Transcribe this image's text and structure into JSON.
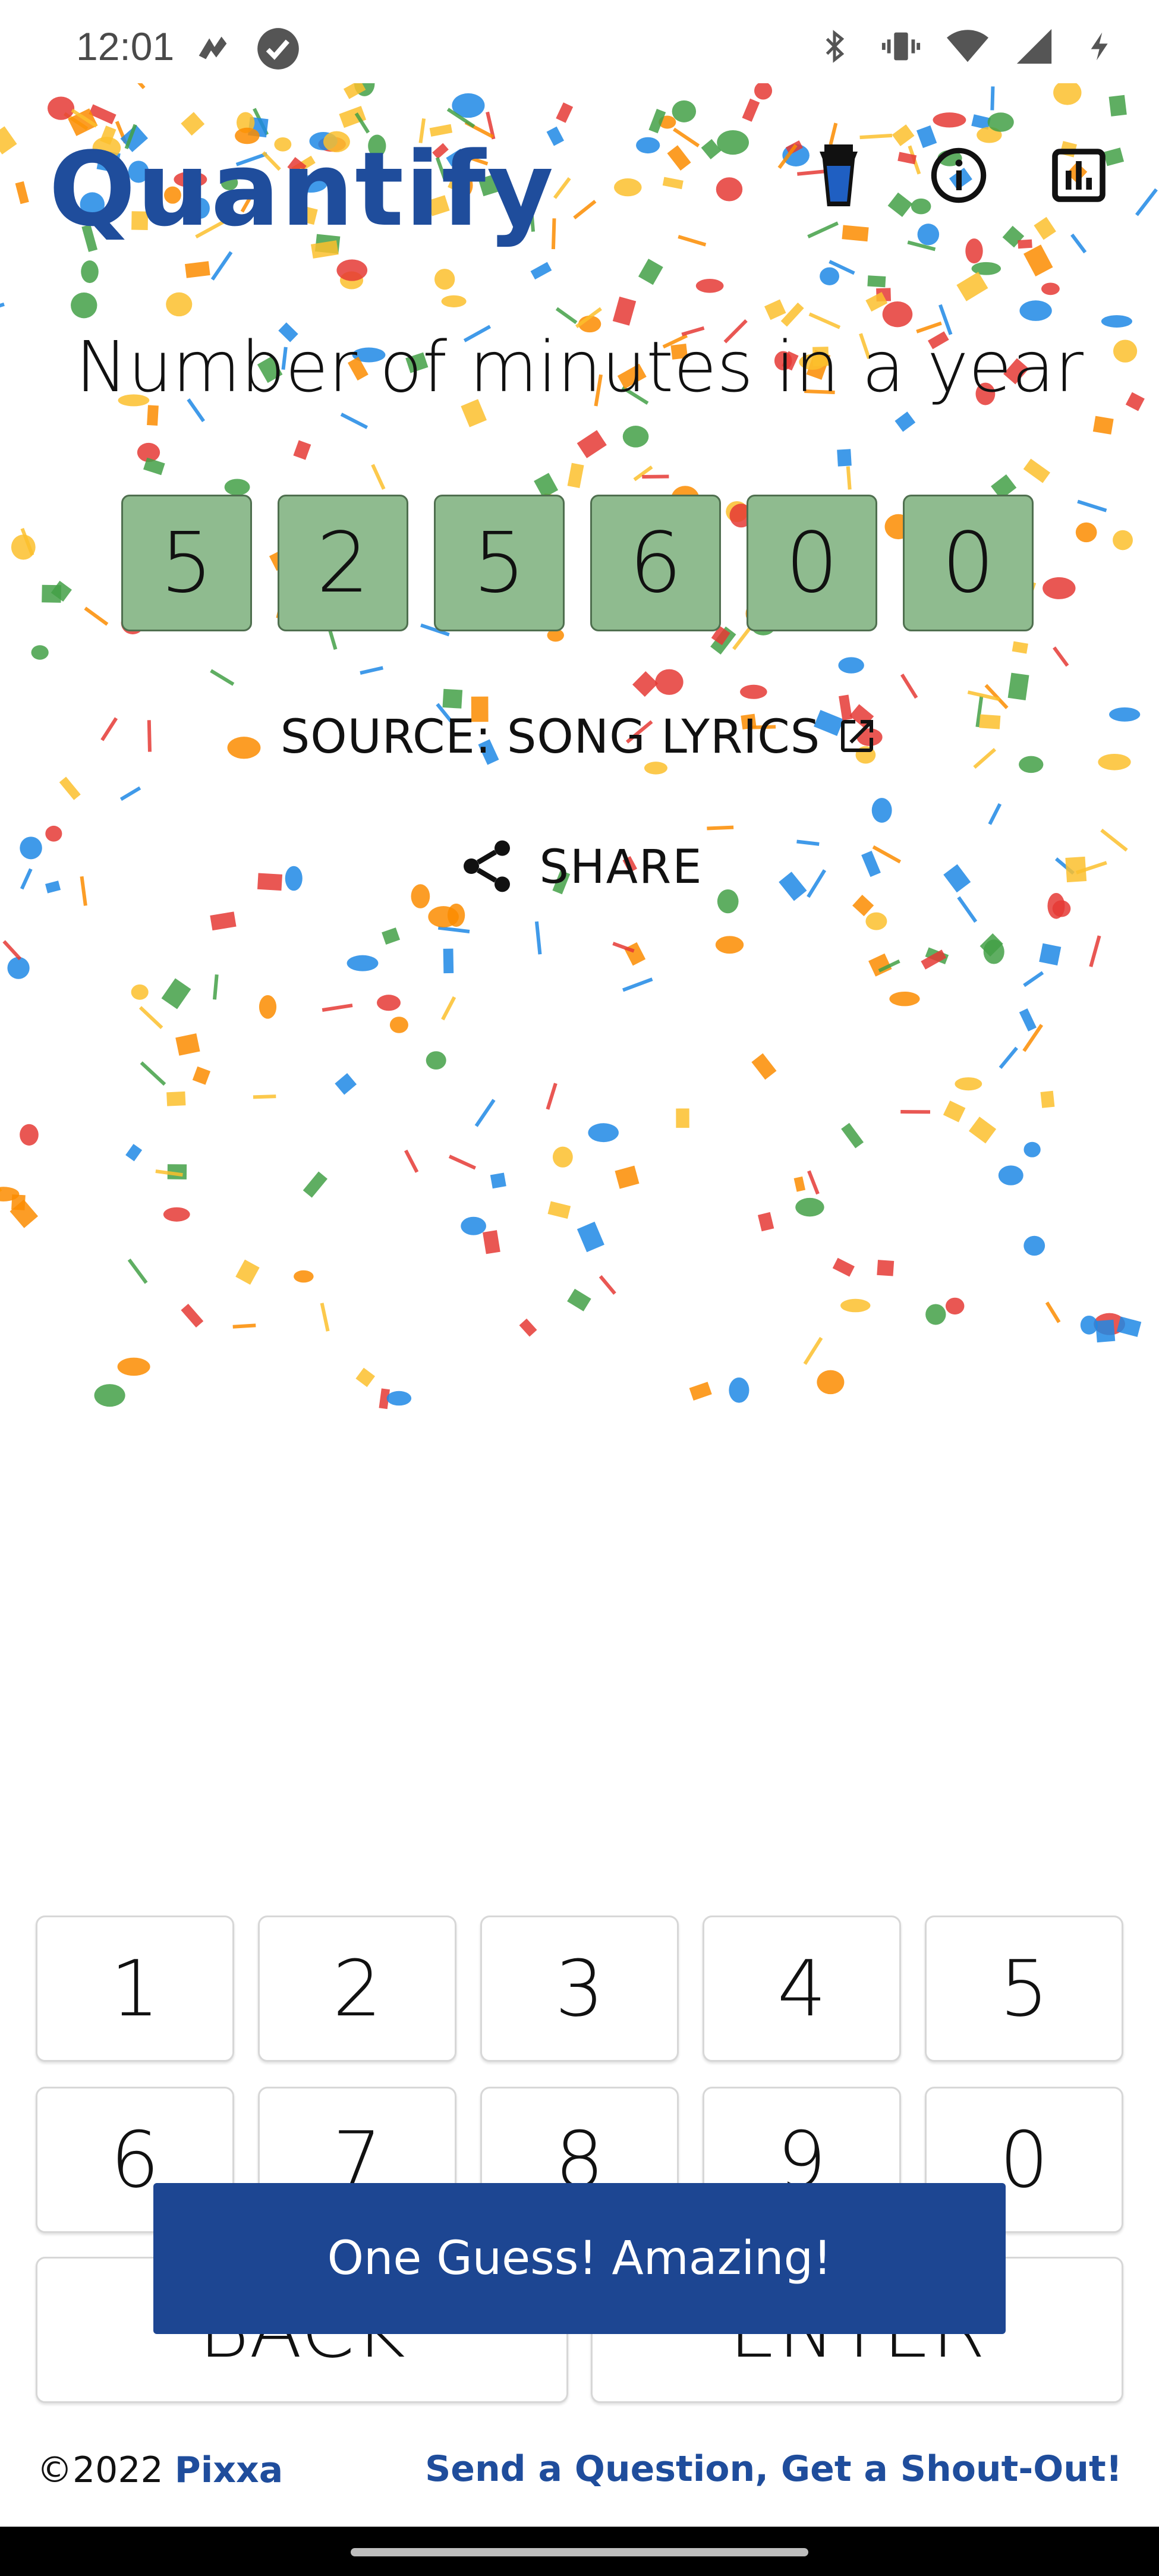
{
  "status_bar": {
    "time": "12:01",
    "left_icons": [
      "cloud-sync-icon",
      "check-circle-icon"
    ],
    "right_icons": [
      "bluetooth-icon",
      "vibrate-icon",
      "wifi-icon",
      "signal-icon",
      "battery-charging-icon"
    ]
  },
  "header": {
    "title": "Quantify",
    "icons": [
      "coffee-cup-icon",
      "info-icon",
      "stats-icon"
    ],
    "brand_color": "#1f4d9c"
  },
  "question": "Number of minutes in a year",
  "answer_digits": [
    "5",
    "2",
    "5",
    "6",
    "0",
    "0"
  ],
  "source": {
    "label": "SOURCE: SONG LYRICS",
    "icon": "external-link-icon"
  },
  "share": {
    "label": "SHARE",
    "icon": "share-icon"
  },
  "keypad": {
    "row1": [
      "1",
      "2",
      "3",
      "4",
      "5"
    ],
    "row2": [
      "6",
      "7",
      "8",
      "9",
      "0"
    ],
    "back_label": "BACK",
    "enter_label": "ENTER"
  },
  "toast": {
    "message": "One Guess! Amazing!",
    "color": "#1d4692"
  },
  "footer": {
    "copyright": "©2022",
    "brand": "Pixxa",
    "cta": "Send a Question, Get a Shout-Out!"
  },
  "colors": {
    "digit_tile": "#8fbb8f",
    "confetti": [
      "#e53935",
      "#fbc02d",
      "#43a047",
      "#1e88e5",
      "#fb8c00"
    ]
  }
}
